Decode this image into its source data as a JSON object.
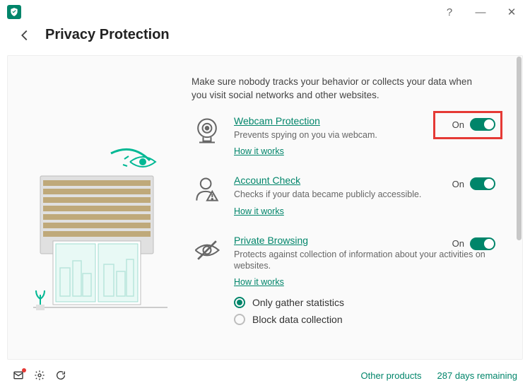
{
  "window": {
    "help": "?",
    "minimize": "—",
    "close": "✕"
  },
  "header": {
    "title": "Privacy Protection"
  },
  "intro": "Make sure nobody tracks your behavior or collects your data when you visit social networks and other websites.",
  "features": [
    {
      "title": "Webcam Protection",
      "desc": "Prevents spying on you via webcam.",
      "how": "How it works",
      "toggle_label": "On",
      "toggle_on": true,
      "highlighted": true
    },
    {
      "title": "Account Check",
      "desc": "Checks if your data became publicly accessible.",
      "how": "How it works",
      "toggle_label": "On",
      "toggle_on": true,
      "highlighted": false
    },
    {
      "title": "Private Browsing",
      "desc": "Protects against collection of information about your activities on websites.",
      "how": "How it works",
      "toggle_label": "On",
      "toggle_on": true,
      "highlighted": false
    }
  ],
  "radio_options": [
    {
      "label": "Only gather statistics",
      "selected": true
    },
    {
      "label": "Block data collection",
      "selected": false
    }
  ],
  "footer": {
    "other_products": "Other products",
    "license": "287 days remaining"
  },
  "colors": {
    "accent": "#00856a",
    "highlight": "#e53935"
  }
}
